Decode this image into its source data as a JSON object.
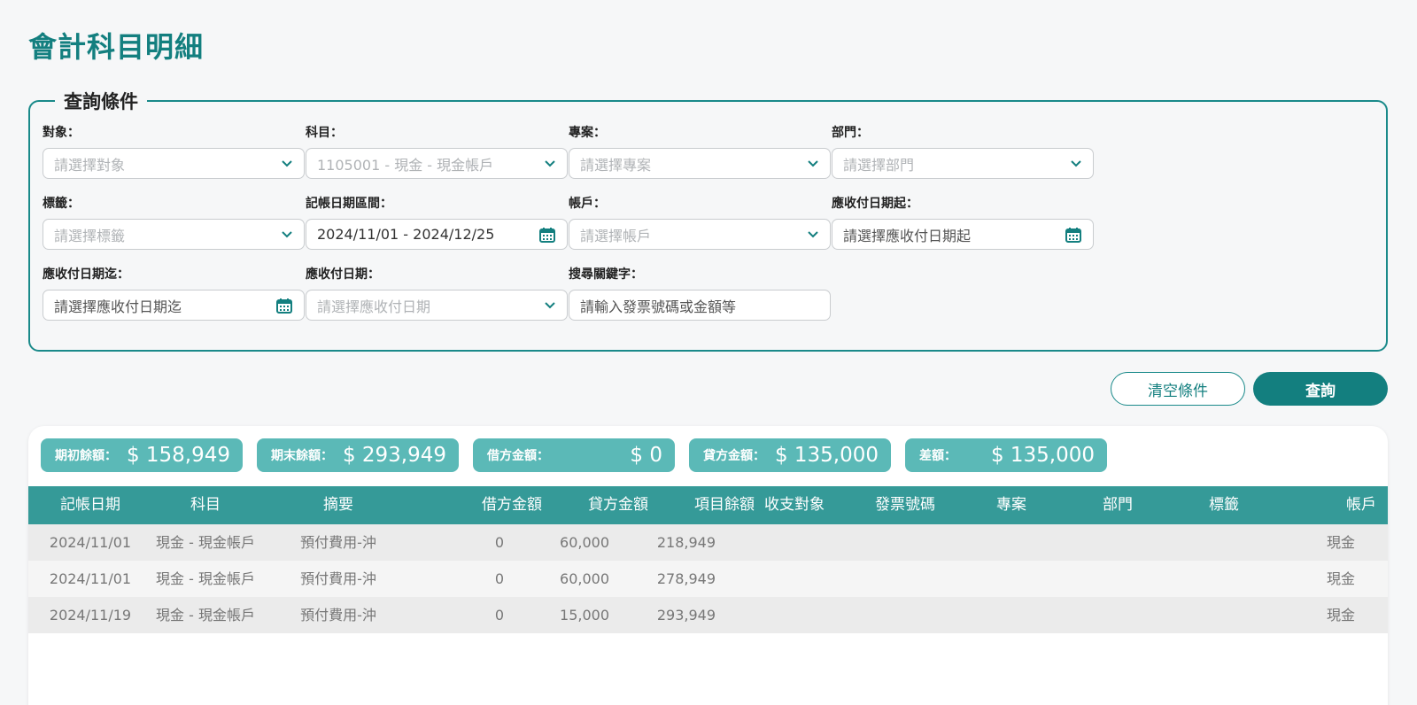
{
  "page": {
    "title": "會計科目明細"
  },
  "query": {
    "legend": "查詢條件",
    "fields": {
      "target": {
        "label": "對象：",
        "placeholder": "請選擇對象"
      },
      "subject": {
        "label": "科目：",
        "value": "1105001 - 現金 - 現金帳戶"
      },
      "project": {
        "label": "專案：",
        "placeholder": "請選擇專案"
      },
      "department": {
        "label": "部門：",
        "placeholder": "請選擇部門"
      },
      "tag": {
        "label": "標籤：",
        "placeholder": "請選擇標籤"
      },
      "date_range": {
        "label": "記帳日期區間：",
        "value": "2024/11/01 - 2024/12/25"
      },
      "account": {
        "label": "帳戶：",
        "placeholder": "請選擇帳戶"
      },
      "due_start": {
        "label": "應收付日期起：",
        "placeholder": "請選擇應收付日期起"
      },
      "due_end": {
        "label": "應收付日期迄：",
        "placeholder": "請選擇應收付日期迄"
      },
      "due_date": {
        "label": "應收付日期：",
        "placeholder": "請選擇應收付日期"
      },
      "keyword": {
        "label": "搜尋關鍵字：",
        "placeholder": "請輸入發票號碼或金額等"
      }
    }
  },
  "actions": {
    "clear_label": "清空條件",
    "query_label": "查詢"
  },
  "summary": [
    {
      "label": "期初餘額：",
      "value": "$ 158,949"
    },
    {
      "label": "期末餘額：",
      "value": "$ 293,949"
    },
    {
      "label": "借方金額：",
      "value": "$ 0"
    },
    {
      "label": "貸方金額：",
      "value": "$ 135,000"
    },
    {
      "label": "差額：",
      "value": "$ 135,000"
    }
  ],
  "table": {
    "headers": [
      "記帳日期",
      "科目",
      "摘要",
      "借方金額",
      "貸方金額",
      "項目餘額",
      "收支對象",
      "發票號碼",
      "專案",
      "部門",
      "標籤",
      "帳戶"
    ],
    "rows": [
      [
        "2024/11/01",
        "現金 - 現金帳戶",
        "預付費用-沖",
        "0",
        "60,000",
        "218,949",
        "",
        "",
        "",
        "",
        "",
        "現金"
      ],
      [
        "2024/11/01",
        "現金 - 現金帳戶",
        "預付費用-沖",
        "0",
        "60,000",
        "278,949",
        "",
        "",
        "",
        "",
        "",
        "現金"
      ],
      [
        "2024/11/19",
        "現金 - 現金帳戶",
        "預付費用-沖",
        "0",
        "15,000",
        "293,949",
        "",
        "",
        "",
        "",
        "",
        "現金"
      ]
    ]
  },
  "colors": {
    "accent": "#137f7f",
    "chip": "#5bb9b7",
    "header": "#359a98"
  },
  "icons": {
    "dropdown": "chevron-down-icon",
    "date": "calendar-icon"
  }
}
